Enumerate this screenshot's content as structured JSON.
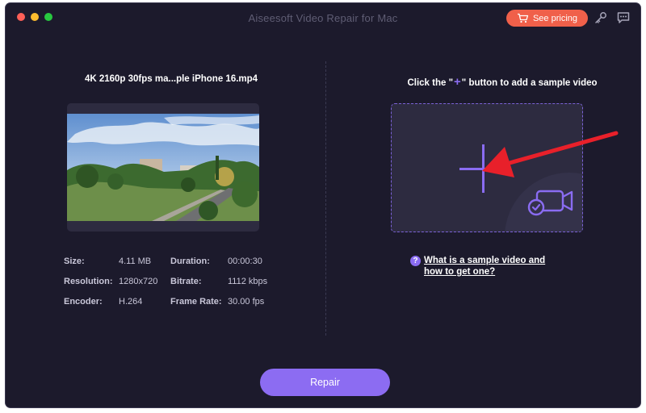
{
  "window": {
    "title": "Aiseesoft Video Repair for Mac",
    "controls": [
      "close",
      "minimize",
      "zoom"
    ]
  },
  "header": {
    "pricing_label": "See pricing",
    "pricing_icon": "cart-icon",
    "icons": [
      "key-icon",
      "chat-icon"
    ],
    "accent_color": "#f0604a"
  },
  "left_panel": {
    "file_name": "4K 2160p 30fps ma...ple iPhone 16.mp4",
    "preview": "video-thumbnail",
    "info": [
      {
        "label": "Size:",
        "value": "4.11 MB"
      },
      {
        "label": "Duration:",
        "value": "00:00:30"
      },
      {
        "label": "Resolution:",
        "value": "1280x720"
      },
      {
        "label": "Bitrate:",
        "value": "1112 kbps"
      },
      {
        "label": "Encoder:",
        "value": "H.264"
      },
      {
        "label": "Frame Rate:",
        "value": "30.00 fps"
      }
    ]
  },
  "right_panel": {
    "instruction_before": "Click the \"",
    "instruction_plus": "+",
    "instruction_after": "\" button to add a sample video",
    "add_icon": "plus-icon",
    "camera_icon": "video-camera-check-icon",
    "help_icon": "?",
    "help_text": "What is a sample video and how to get one?"
  },
  "footer": {
    "repair_label": "Repair",
    "repair_color": "#8c6cf2"
  },
  "theme": {
    "background": "#1c1a2c",
    "card": "#2d2b40",
    "accent": "#8a6cf2",
    "annotation_arrow": "#e8202a"
  }
}
